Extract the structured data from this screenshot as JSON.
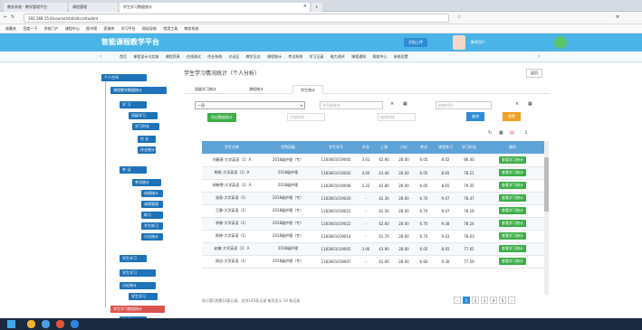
{
  "browser": {
    "tabs": [
      "教务系统 - 教学管理平台",
      "课程管理",
      "学生学习数据统计"
    ],
    "url": "192.168.15.6/course/statistics/student",
    "bookmarks": [
      "收藏夹",
      "百度一下",
      "学校门户",
      "课程中心",
      "图书馆",
      "资源库",
      "学习平台",
      "网站导航",
      "常用工具",
      "教务系统"
    ]
  },
  "app": {
    "title": "智能课程教学平台",
    "user": "教师用户",
    "upload": "文档上传"
  },
  "nav": [
    "首页",
    "课程设计与实施",
    "课程资源",
    "在线测试",
    "作业系统",
    "讨论区",
    "教学日志",
    "课程统计",
    "考试系统",
    "学习记录",
    "能力测评",
    "课程通知",
    "帮助中心",
    "系统设置"
  ],
  "sidebar": {
    "top": "个人空间",
    "items": [
      "课程教学数据统计",
      "学 习",
      "班级学习",
      "学习时长",
      "作 业",
      "作业统计",
      "成绩管理",
      "考 试",
      "考试统计",
      "成绩统计",
      "练习",
      "学生练习",
      "讨论统计",
      "学生学习",
      "学生学习数据统计",
      "学 生"
    ]
  },
  "content": {
    "title": "学生学习情况统计（个人分析）",
    "back": "返回",
    "tabs": [
      "班级学习统计",
      "课程统计",
      "学生统计"
    ],
    "filters": {
      "class_value": "一班",
      "keyword_ph": "学号或姓名",
      "start_ph": "开始时间",
      "end_ph": "结束时间",
      "export": "导出数据统计",
      "search": "查询",
      "reset": "重置"
    },
    "columns": [
      "学生名称",
      "学院班级",
      "学生学号",
      "作业",
      "上课",
      "讨论",
      "考试",
      "课堂练习",
      "学习时长",
      "操作"
    ],
    "rows": [
      [
        "刘春燕-大学英语（1）A",
        "2018级护理（专）",
        "1183601019005",
        "3.01",
        "42.90",
        "28.00",
        "6.05",
        "8.02",
        "86.40"
      ],
      [
        "杨帆-大学英语（1）A",
        "2018级护理",
        "1183601019002",
        "3.00",
        "43.40",
        "28.00",
        "6.05",
        "8.65",
        "78.21"
      ],
      [
        "胡晓雪-大学英语（1）A",
        "2018级护理",
        "1183601019008",
        "3.22",
        "42.80",
        "28.00",
        "6.05",
        "8.65",
        "79.35"
      ],
      [
        "张丽-大学英语（1）",
        "2018级护理（专）",
        "1183601019020",
        "-",
        "42.30",
        "28.00",
        "6.70",
        "9.47",
        "78.47"
      ],
      [
        "王静-大学英语（1）",
        "2018级护理（专）",
        "1183601019021",
        "-",
        "42.50",
        "28.00",
        "6.70",
        "9.47",
        "78.19"
      ],
      [
        "李娜-大学英语（1）",
        "2018级护理（专）",
        "1183601019022",
        "-",
        "42.60",
        "28.00",
        "6.70",
        "9.38",
        "78.24"
      ],
      [
        "陈婷-大学英语（1）",
        "2018级护理（专）",
        "1183601019014",
        "-",
        "41.70",
        "28.00",
        "6.70",
        "9.43",
        "78.03"
      ],
      [
        "赵敏-大学英语（1）A",
        "2018级护理",
        "1183601019005",
        "3.00",
        "43.90",
        "28.00",
        "6.05",
        "8.65",
        "77.65"
      ],
      [
        "周洁-大学英语（1）",
        "2018级护理（专）",
        "1183601019007",
        "-",
        "42.00",
        "28.00",
        "6.60",
        "9.30",
        "77.59"
      ]
    ],
    "op_label": "查看学习统计",
    "footer": "显示第1到第10条记录，总共145条记录 每页显示 10 条记录",
    "pages": [
      "1",
      "2",
      "3",
      "4",
      "5"
    ]
  }
}
